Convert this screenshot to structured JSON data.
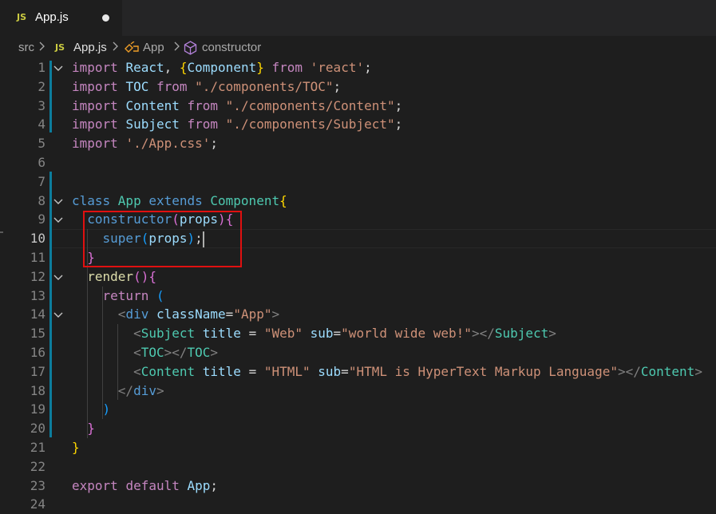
{
  "tab": {
    "icon": "JS",
    "label": "App.js"
  },
  "breadcrumb": {
    "folder": "src",
    "file_icon": "JS",
    "file": "App.js",
    "class": "App",
    "method": "constructor"
  },
  "lines": [
    {
      "n": "1",
      "tokens": [
        [
          "kw",
          "import "
        ],
        [
          "id",
          "React"
        ],
        [
          "plain",
          ", "
        ],
        [
          "br3",
          "{"
        ],
        [
          "id",
          "Component"
        ],
        [
          "br3",
          "}"
        ],
        [
          "kw",
          " from "
        ],
        [
          "str",
          "'react'"
        ],
        [
          "plain",
          ";"
        ]
      ]
    },
    {
      "n": "2",
      "tokens": [
        [
          "kw",
          "import "
        ],
        [
          "id",
          "TOC"
        ],
        [
          "kw",
          " from "
        ],
        [
          "str",
          "\"./components/TOC\""
        ],
        [
          "plain",
          ";"
        ]
      ]
    },
    {
      "n": "3",
      "tokens": [
        [
          "kw",
          "import "
        ],
        [
          "id",
          "Content"
        ],
        [
          "kw",
          " from "
        ],
        [
          "str",
          "\"./components/Content\""
        ],
        [
          "plain",
          ";"
        ]
      ]
    },
    {
      "n": "4",
      "tokens": [
        [
          "kw",
          "import "
        ],
        [
          "id",
          "Subject"
        ],
        [
          "kw",
          " from "
        ],
        [
          "str",
          "\"./components/Subject\""
        ],
        [
          "plain",
          ";"
        ]
      ]
    },
    {
      "n": "5",
      "tokens": [
        [
          "kw",
          "import "
        ],
        [
          "str",
          "'./App.css'"
        ],
        [
          "plain",
          ";"
        ]
      ]
    },
    {
      "n": "6",
      "tokens": []
    },
    {
      "n": "7",
      "tokens": []
    },
    {
      "n": "8",
      "tokens": [
        [
          "kw2",
          "class "
        ],
        [
          "cls",
          "App "
        ],
        [
          "kw2",
          "extends "
        ],
        [
          "cls",
          "Component"
        ],
        [
          "br3",
          "{"
        ]
      ]
    },
    {
      "n": "9",
      "tokens": [
        [
          "plain",
          "  "
        ],
        [
          "kw2",
          "constructor"
        ],
        [
          "br",
          "("
        ],
        [
          "id",
          "props"
        ],
        [
          "br",
          ")"
        ],
        [
          "br",
          "{"
        ]
      ]
    },
    {
      "n": "10",
      "tokens": [
        [
          "plain",
          "    "
        ],
        [
          "kw2",
          "super"
        ],
        [
          "br2",
          "("
        ],
        [
          "id",
          "props"
        ],
        [
          "br2",
          ")"
        ],
        [
          "plain",
          ";"
        ]
      ]
    },
    {
      "n": "11",
      "tokens": [
        [
          "plain",
          "  "
        ],
        [
          "br",
          "}"
        ]
      ]
    },
    {
      "n": "12",
      "tokens": [
        [
          "plain",
          "  "
        ],
        [
          "fn",
          "render"
        ],
        [
          "br",
          "()"
        ],
        [
          "br",
          "{"
        ]
      ]
    },
    {
      "n": "13",
      "tokens": [
        [
          "plain",
          "    "
        ],
        [
          "kw",
          "return "
        ],
        [
          "br2",
          "("
        ]
      ]
    },
    {
      "n": "14",
      "tokens": [
        [
          "plain",
          "      "
        ],
        [
          "tag",
          "<"
        ],
        [
          "kw2",
          "div "
        ],
        [
          "attr",
          "className"
        ],
        [
          "plain",
          "="
        ],
        [
          "str",
          "\"App\""
        ],
        [
          "tag",
          ">"
        ]
      ]
    },
    {
      "n": "15",
      "tokens": [
        [
          "plain",
          "        "
        ],
        [
          "tag",
          "<"
        ],
        [
          "cls",
          "Subject "
        ],
        [
          "attr",
          "title "
        ],
        [
          "plain",
          "= "
        ],
        [
          "str",
          "\"Web\" "
        ],
        [
          "attr",
          "sub"
        ],
        [
          "plain",
          "="
        ],
        [
          "str",
          "\"world wide web!\""
        ],
        [
          "tag",
          "></"
        ],
        [
          "cls",
          "Subject"
        ],
        [
          "tag",
          ">"
        ]
      ]
    },
    {
      "n": "16",
      "tokens": [
        [
          "plain",
          "        "
        ],
        [
          "tag",
          "<"
        ],
        [
          "cls",
          "TOC"
        ],
        [
          "tag",
          "></"
        ],
        [
          "cls",
          "TOC"
        ],
        [
          "tag",
          ">"
        ]
      ]
    },
    {
      "n": "17",
      "tokens": [
        [
          "plain",
          "        "
        ],
        [
          "tag",
          "<"
        ],
        [
          "cls",
          "Content "
        ],
        [
          "attr",
          "title "
        ],
        [
          "plain",
          "= "
        ],
        [
          "str",
          "\"HTML\" "
        ],
        [
          "attr",
          "sub"
        ],
        [
          "plain",
          "="
        ],
        [
          "str",
          "\"HTML is HyperText Markup Language\""
        ],
        [
          "tag",
          "></"
        ],
        [
          "cls",
          "Content"
        ],
        [
          "tag",
          ">"
        ]
      ]
    },
    {
      "n": "18",
      "tokens": [
        [
          "plain",
          "      "
        ],
        [
          "tag",
          "</"
        ],
        [
          "kw2",
          "div"
        ],
        [
          "tag",
          ">"
        ]
      ]
    },
    {
      "n": "19",
      "tokens": [
        [
          "plain",
          "    "
        ],
        [
          "br2",
          ")"
        ]
      ]
    },
    {
      "n": "20",
      "tokens": [
        [
          "plain",
          "  "
        ],
        [
          "br",
          "}"
        ]
      ]
    },
    {
      "n": "21",
      "tokens": [
        [
          "br3",
          "}"
        ]
      ]
    },
    {
      "n": "22",
      "tokens": []
    },
    {
      "n": "23",
      "tokens": [
        [
          "kw",
          "export "
        ],
        [
          "kw",
          "default "
        ],
        [
          "id",
          "App"
        ],
        [
          "plain",
          ";"
        ]
      ]
    },
    {
      "n": "24",
      "tokens": []
    }
  ],
  "active_line": "10",
  "fold_lines": [
    "1",
    "8",
    "9",
    "12",
    "14"
  ]
}
